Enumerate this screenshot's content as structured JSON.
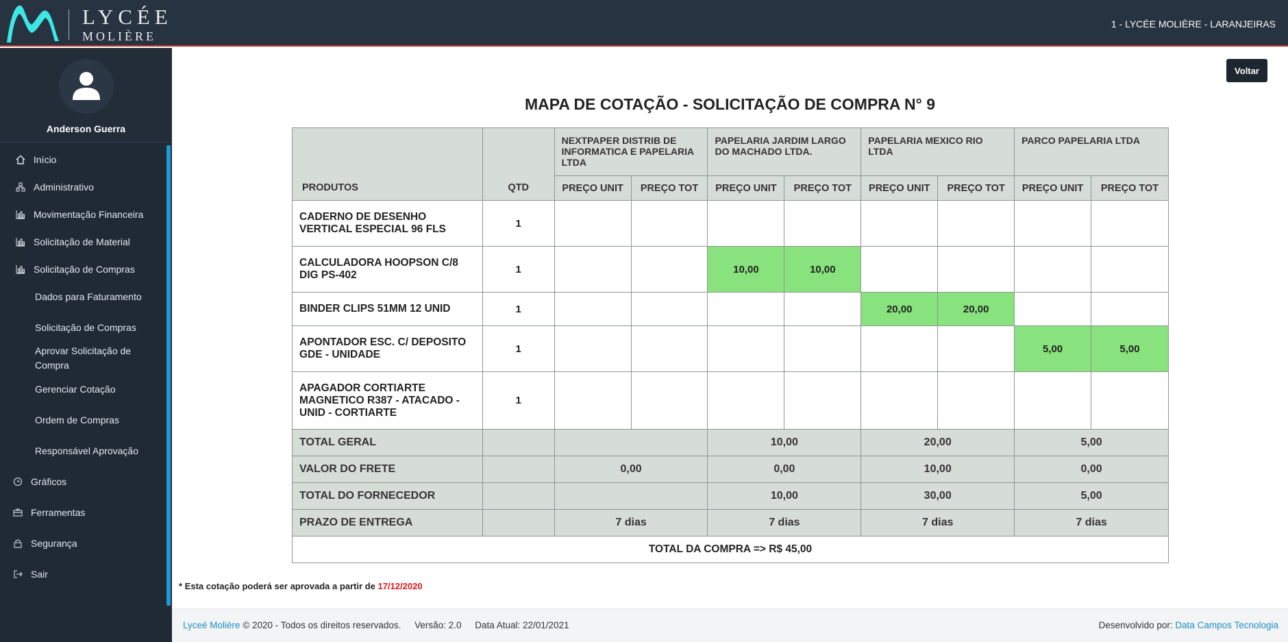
{
  "header": {
    "logo_line1": "LYCÉE",
    "logo_line2": "MOLIÈRE",
    "school": "1 - LYCÉE MOLIÈRE - LARANJEIRAS",
    "accent_color": "#3ee6e6"
  },
  "sidebar": {
    "user_name": "Anderson Guerra",
    "items": [
      {
        "label": "Início",
        "icon": "home-icon"
      },
      {
        "label": "Administrativo",
        "icon": "sitemap-icon"
      },
      {
        "label": "Movimentação Financeira",
        "icon": "bar-chart-icon"
      },
      {
        "label": "Solicitação de Material",
        "icon": "bar-chart-icon"
      },
      {
        "label": "Solicitação de Compras",
        "icon": "bar-chart-icon"
      },
      {
        "label": "Dados para Faturamento"
      },
      {
        "label": "Solicitação de Compras"
      },
      {
        "label": "Aprovar Solicitação de Compra"
      },
      {
        "label": "Gerenciar Cotação"
      },
      {
        "label": "Ordem de Compras"
      },
      {
        "label": "Responsável Aprovação"
      },
      {
        "label": "Gráficos",
        "icon": "history-icon"
      },
      {
        "label": "Ferramentas",
        "icon": "briefcase-icon"
      },
      {
        "label": "Segurança",
        "icon": "lock-icon"
      },
      {
        "label": "Sair",
        "icon": "sign-out-icon"
      }
    ]
  },
  "main": {
    "back_label": "Voltar",
    "title": "MAPA DE COTAÇÃO - SOLICITAÇÃO DE COMPRA N° 9",
    "table": {
      "col_produtos": "PRODUTOS",
      "col_qtd": "QTD",
      "col_unit": "PREÇO UNIT",
      "col_tot": "PREÇO TOT",
      "suppliers": [
        "NEXTPAPER DISTRIB DE INFORMATICA E PAPELARIA LTDA",
        "PAPELARIA JARDIM LARGO DO MACHADO LTDA.",
        "PAPELARIA MEXICO RIO LTDA",
        "PARCO PAPELARIA LTDA"
      ],
      "rows": [
        {
          "product": "CADERNO DE DESENHO VERTICAL ESPECIAL 96 FLS",
          "qty": "1",
          "prices": [
            "",
            "",
            "",
            "",
            "",
            "",
            "",
            ""
          ]
        },
        {
          "product": "CALCULADORA HOOPSON C/8 DIG PS-402",
          "qty": "1",
          "prices": [
            "",
            "",
            "10,00",
            "10,00",
            "",
            "",
            "",
            ""
          ]
        },
        {
          "product": "BINDER CLIPS 51MM 12 UNID",
          "qty": "1",
          "prices": [
            "",
            "",
            "",
            "",
            "20,00",
            "20,00",
            "",
            ""
          ]
        },
        {
          "product": "APONTADOR ESC. C/ DEPOSITO GDE - UNIDADE",
          "qty": "1",
          "prices": [
            "",
            "",
            "",
            "",
            "",
            "",
            "5,00",
            "5,00"
          ]
        },
        {
          "product": "APAGADOR CORTIARTE MAGNETICO R387 - ATACADO - UNID - CORTIARTE",
          "qty": "1",
          "prices": [
            "",
            "",
            "",
            "",
            "",
            "",
            "",
            ""
          ]
        }
      ],
      "summary": [
        {
          "label": "TOTAL GERAL",
          "values": [
            "",
            "10,00",
            "20,00",
            "5,00"
          ]
        },
        {
          "label": "VALOR DO FRETE",
          "values": [
            "0,00",
            "0,00",
            "10,00",
            "0,00"
          ]
        },
        {
          "label": "TOTAL DO FORNECEDOR",
          "values": [
            "",
            "10,00",
            "30,00",
            "5,00"
          ]
        },
        {
          "label": "PRAZO DE ENTREGA",
          "values": [
            "7 dias",
            "7 dias",
            "7 dias",
            "7 dias"
          ]
        }
      ],
      "grand_total": "TOTAL DA COMPRA => R$ 45,00",
      "highlight_color": "#88e27d"
    },
    "note_prefix": "* Esta cotação poderá ser aprovada a partir de",
    "note_date": "17/12/2020"
  },
  "footer": {
    "brand": "Lyceé Molière",
    "copyright": "© 2020 - Todos os direitos reservados.",
    "version": "Versão: 2.0",
    "date": "Data Atual: 22/01/2021",
    "dev_prefix": "Desenvolvido por:",
    "dev_name": "Data Campos Tecnologia"
  }
}
